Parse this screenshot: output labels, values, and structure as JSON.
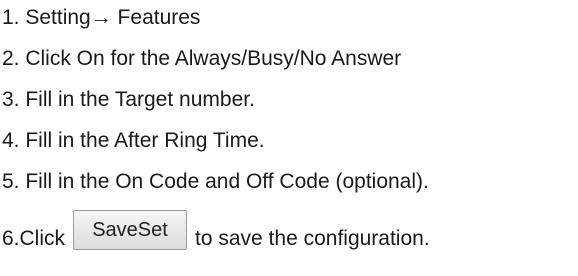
{
  "steps": [
    "1. Setting→ Features",
    "2. Click On for the Always/Busy/No Answer",
    "3. Fill in the Target number.",
    "4. Fill in the After Ring Time.",
    "5. Fill in the On Code and Off Code (optional)."
  ],
  "step6": {
    "prefix": "6.Click",
    "button_label": "SaveSet",
    "suffix": "to save the configuration."
  }
}
